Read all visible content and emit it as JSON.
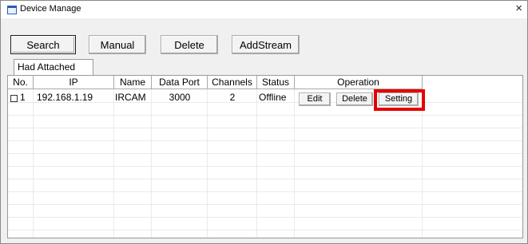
{
  "window": {
    "title": "Device Manage",
    "close_symbol": "×",
    "icon": "app-icon",
    "close_icon": "close-icon"
  },
  "toolbar": {
    "search_label": "Search",
    "manual_label": "Manual",
    "delete_label": "Delete",
    "addstream_label": "AddStream"
  },
  "tab": {
    "label": "Had Attached"
  },
  "table": {
    "columns": {
      "no": "No.",
      "ip": "IP",
      "name": "Name",
      "data_port": "Data Port",
      "channels": "Channels",
      "status": "Status",
      "operation": "Operation"
    },
    "rows": [
      {
        "checked": false,
        "no": "1",
        "ip": "192.168.1.19",
        "name": "IRCAM",
        "data_port": "3000",
        "channels": "2",
        "status": "Offline",
        "edit_label": "Edit",
        "delete_label": "Delete",
        "setting_label": "Setting"
      }
    ]
  },
  "colors": {
    "highlight": "#e60000",
    "window_bg": "#f0f0f0"
  }
}
